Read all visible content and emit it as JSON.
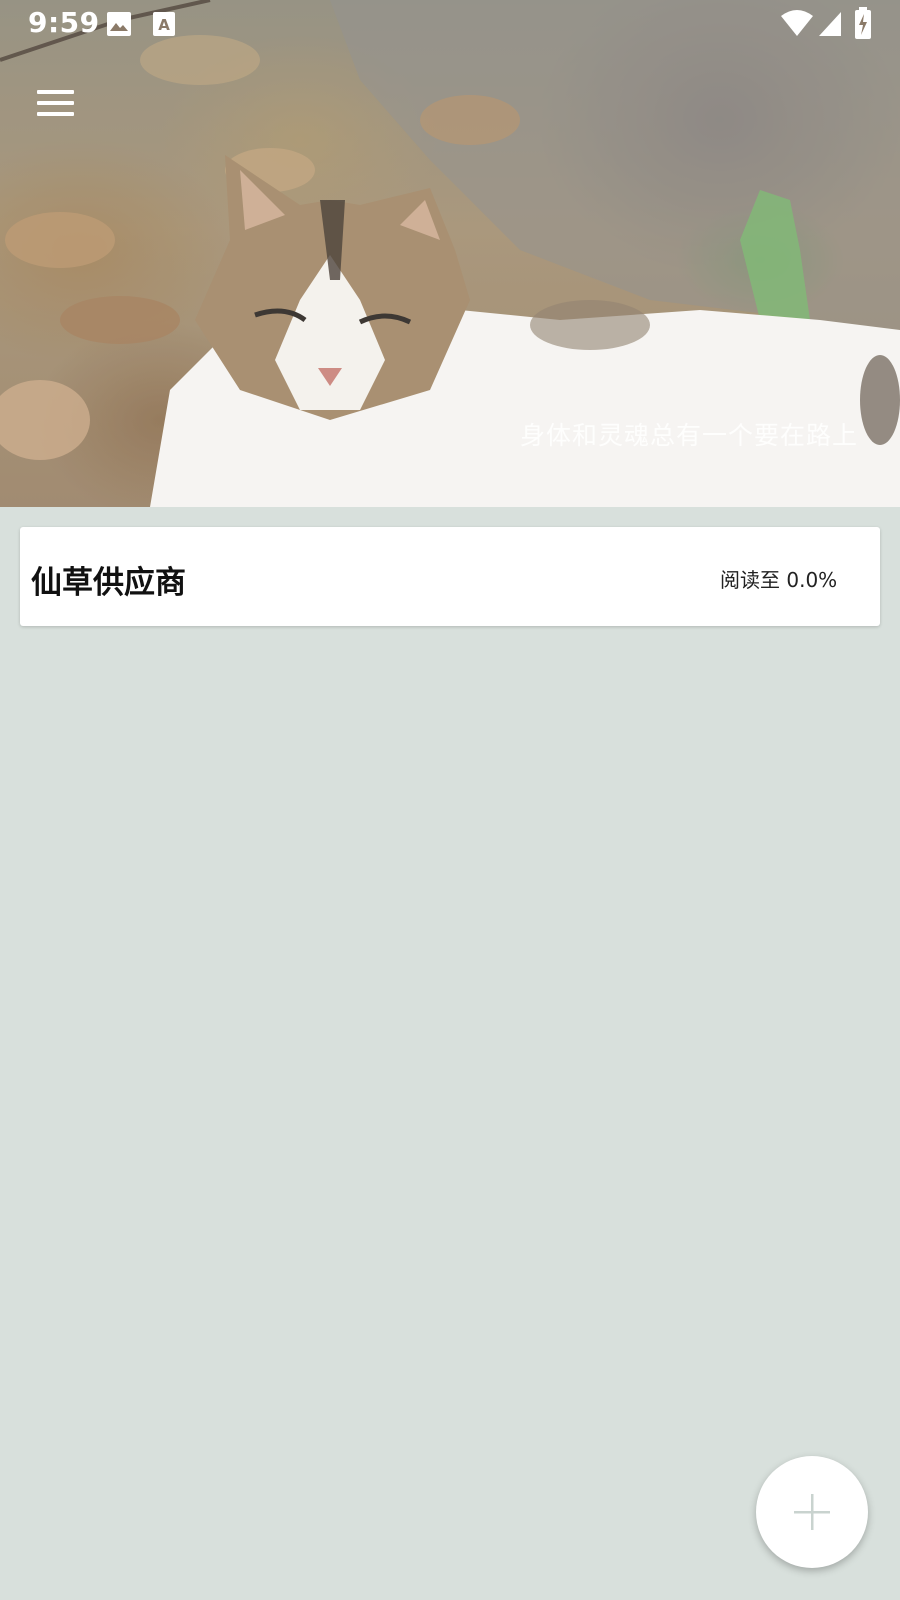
{
  "status_bar": {
    "time": "9:59",
    "icons": [
      "image-notification-icon",
      "text-notification-icon",
      "wifi-icon",
      "cell-signal-icon",
      "battery-charging-icon"
    ]
  },
  "toolbar": {
    "menu_icon": "hamburger-menu-icon"
  },
  "header": {
    "background": "cat-photo",
    "quote": "身体和灵魂总有一个要在路上"
  },
  "books": [
    {
      "title": "仙草供应商",
      "progress_label": "阅读至 0.0%"
    }
  ],
  "fab": {
    "icon": "plus-icon"
  },
  "colors": {
    "background": "#d8e0dc",
    "card": "#ffffff",
    "fab_icon": "#c9d3cf"
  }
}
